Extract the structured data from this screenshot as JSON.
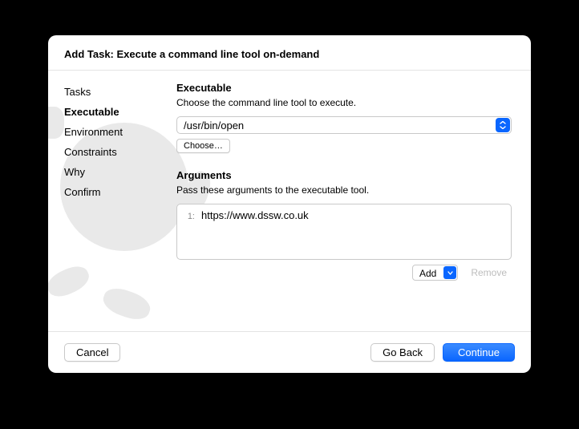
{
  "title": "Add Task: Execute a command line tool on-demand",
  "sidebar": {
    "items": [
      {
        "label": "Tasks"
      },
      {
        "label": "Executable"
      },
      {
        "label": "Environment"
      },
      {
        "label": "Constraints"
      },
      {
        "label": "Why"
      },
      {
        "label": "Confirm"
      }
    ],
    "active_index": 1
  },
  "executable": {
    "heading": "Executable",
    "sub": "Choose the command line tool to execute.",
    "value": "/usr/bin/open",
    "choose_label": "Choose…"
  },
  "arguments": {
    "heading": "Arguments",
    "sub": "Pass these arguments to the executable tool.",
    "items": [
      {
        "index": "1:",
        "value": "https://www.dssw.co.uk"
      }
    ],
    "add_label": "Add",
    "remove_label": "Remove"
  },
  "footer": {
    "cancel": "Cancel",
    "back": "Go Back",
    "continue": "Continue"
  }
}
